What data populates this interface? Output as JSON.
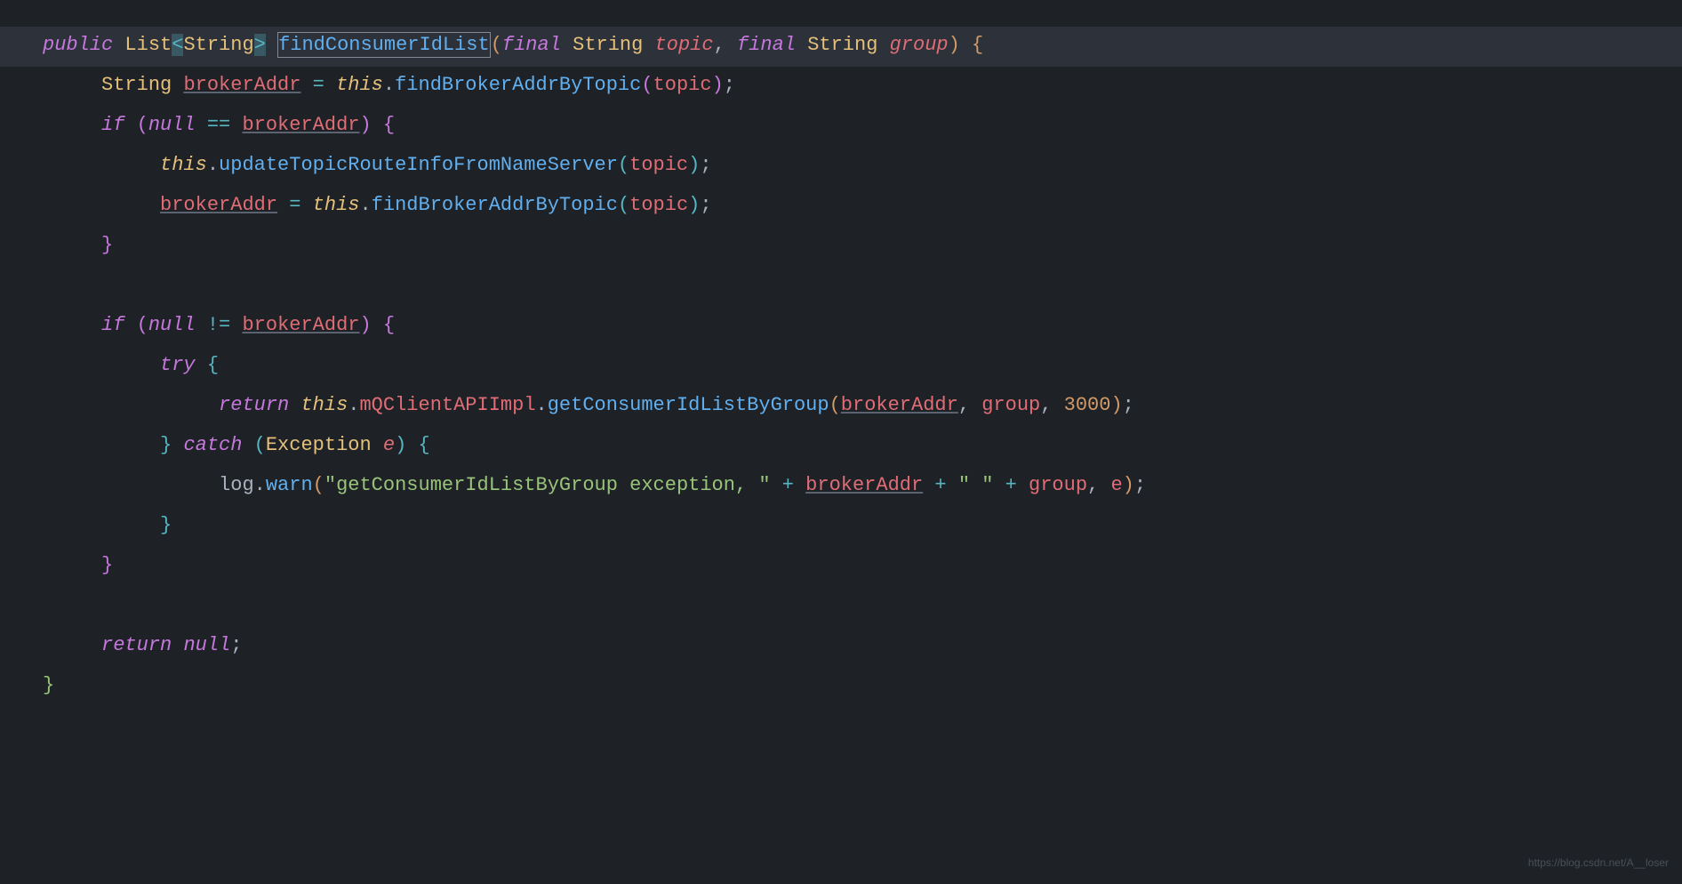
{
  "watermark": "https://blog.csdn.net/A__loser",
  "code": {
    "line1": {
      "public": "public",
      "list": "List",
      "lt": "<",
      "string": "String",
      "gt": ">",
      "method": "findConsumerIdList",
      "lparen": "(",
      "final1": "final",
      "stringtype1": "String",
      "topic": "topic",
      "comma": ",",
      "final2": "final",
      "stringtype2": "String",
      "group": "group",
      "rparen": ")",
      "lbrace": "{"
    },
    "line2": {
      "stringtype": "String",
      "brokerAddr": "brokerAddr",
      "eq": "=",
      "this": "this",
      "dot": ".",
      "method": "findBrokerAddrByTopic",
      "lparen": "(",
      "topic": "topic",
      "rparen": ")",
      "semi": ";"
    },
    "line3": {
      "if": "if",
      "lparen": "(",
      "null": "null",
      "eqeq": "==",
      "brokerAddr": "brokerAddr",
      "rparen": ")",
      "lbrace": "{"
    },
    "line4": {
      "this": "this",
      "dot": ".",
      "method": "updateTopicRouteInfoFromNameServer",
      "lparen": "(",
      "topic": "topic",
      "rparen": ")",
      "semi": ";"
    },
    "line5": {
      "brokerAddr": "brokerAddr",
      "eq": "=",
      "this": "this",
      "dot": ".",
      "method": "findBrokerAddrByTopic",
      "lparen": "(",
      "topic": "topic",
      "rparen": ")",
      "semi": ";"
    },
    "line6": {
      "rbrace": "}"
    },
    "line8": {
      "if": "if",
      "lparen": "(",
      "null": "null",
      "neq": "!=",
      "brokerAddr": "brokerAddr",
      "rparen": ")",
      "lbrace": "{"
    },
    "line9": {
      "try": "try",
      "lbrace": "{"
    },
    "line10": {
      "return": "return",
      "this": "this",
      "dot1": ".",
      "field": "mQClientAPIImpl",
      "dot2": ".",
      "method": "getConsumerIdListByGroup",
      "lparen": "(",
      "brokerAddr": "brokerAddr",
      "comma1": ",",
      "group": "group",
      "comma2": ",",
      "num": "3000",
      "rparen": ")",
      "semi": ";"
    },
    "line11": {
      "rbrace": "}",
      "catch": "catch",
      "lparen": "(",
      "exception": "Exception",
      "e": "e",
      "rparen": ")",
      "lbrace": "{"
    },
    "line12": {
      "log": "log",
      "dot": ".",
      "warn": "warn",
      "lparen": "(",
      "str1": "\"getConsumerIdListByGroup exception, \"",
      "plus1": "+",
      "brokerAddr": "brokerAddr",
      "plus2": "+",
      "str2": "\" \"",
      "plus3": "+",
      "group": "group",
      "comma": ",",
      "e": "e",
      "rparen": ")",
      "semi": ";"
    },
    "line13": {
      "rbrace": "}"
    },
    "line14": {
      "rbrace": "}"
    },
    "line16": {
      "return": "return",
      "null": "null",
      "semi": ";"
    },
    "line17": {
      "rbrace": "}"
    }
  }
}
